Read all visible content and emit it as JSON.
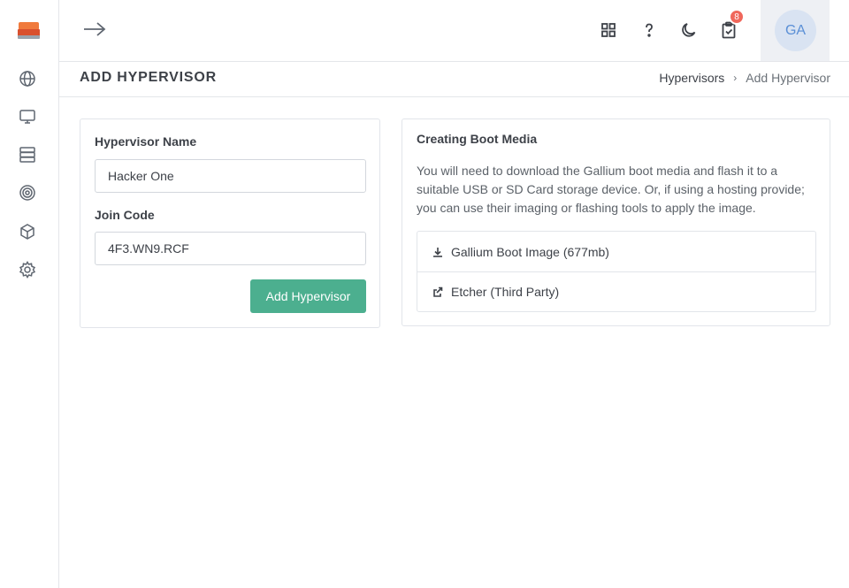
{
  "page": {
    "title": "ADD HYPERVISOR"
  },
  "breadcrumb": {
    "parent": "Hypervisors",
    "current": "Add Hypervisor"
  },
  "topbar": {
    "notifications_count": "8",
    "avatar_initials": "GA"
  },
  "sidebar": {
    "items": [
      {
        "icon": "globe-icon"
      },
      {
        "icon": "monitor-icon"
      },
      {
        "icon": "server-icon"
      },
      {
        "icon": "target-icon"
      },
      {
        "icon": "package-icon"
      },
      {
        "icon": "gear-icon"
      }
    ]
  },
  "form": {
    "name_label": "Hypervisor Name",
    "name_value": "Hacker One",
    "join_label": "Join Code",
    "join_value": "4F3.WN9.RCF",
    "submit_label": "Add Hypervisor"
  },
  "boot_media": {
    "title": "Creating Boot Media",
    "description": "You will need to download the Gallium boot media and flash it to a suitable USB or SD Card storage device. Or, if using a hosting provide; you can use their imaging or flashing tools to apply the image.",
    "links": [
      {
        "label": "Gallium Boot Image (677mb)",
        "icon": "download-icon"
      },
      {
        "label": "Etcher (Third Party)",
        "icon": "external-link-icon"
      }
    ]
  },
  "colors": {
    "accent": "#4caf8f",
    "badge": "#f0675b",
    "logo": "#e8643a"
  }
}
